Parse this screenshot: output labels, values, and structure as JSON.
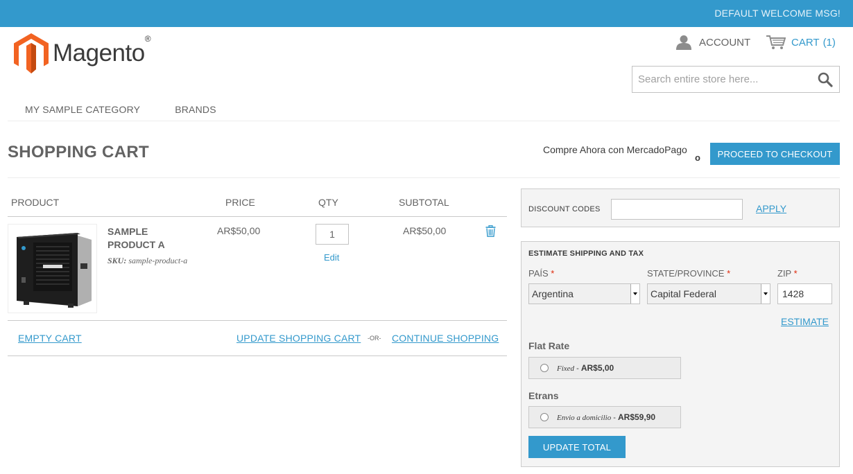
{
  "header": {
    "welcome": "DEFAULT WELCOME MSG!",
    "logo_text": "Magento",
    "logo_mark": "®",
    "account_label": "ACCOUNT",
    "cart_label": "CART",
    "cart_count": "(1)",
    "search_placeholder": "Search entire store here...",
    "accent_color": "#3399cc",
    "logo_color": "#f26322"
  },
  "nav": {
    "items": [
      {
        "label": "MY SAMPLE CATEGORY"
      },
      {
        "label": "BRANDS"
      }
    ]
  },
  "page": {
    "title": "SHOPPING CART",
    "mercadopago_text": "Compre Ahora con MercadoPago",
    "mercadopago_o": "o",
    "checkout_button": "PROCEED TO CHECKOUT"
  },
  "cart_table": {
    "headers": {
      "product": "PRODUCT",
      "price": "PRICE",
      "qty": "QTY",
      "subtotal": "SUBTOTAL"
    },
    "items": [
      {
        "name": "SAMPLE PRODUCT A",
        "sku_label": "SKU:",
        "sku": "sample-product-a",
        "price": "AR$50,00",
        "qty": "1",
        "edit_label": "Edit",
        "subtotal": "AR$50,00",
        "image_icon": "nas-device-image",
        "remove_icon": "trash-icon"
      }
    ],
    "actions": {
      "empty_cart": "EMPTY CART",
      "update_cart": "UPDATE SHOPPING CART",
      "or": "-OR-",
      "continue_shopping": "CONTINUE SHOPPING"
    }
  },
  "discount": {
    "label": "DISCOUNT CODES",
    "value": "",
    "apply": "APPLY"
  },
  "shipping": {
    "title": "ESTIMATE SHIPPING AND TAX",
    "country_label": "PAÍS",
    "country_value": "Argentina",
    "state_label": "STATE/PROVINCE",
    "state_value": "Capital Federal",
    "zip_label": "ZIP",
    "zip_value": "1428",
    "required_mark": "*",
    "estimate_link": "ESTIMATE",
    "methods": [
      {
        "title": "Flat Rate",
        "option": "Fixed",
        "sep": " - ",
        "price": "AR$5,00"
      },
      {
        "title": "Etrans",
        "option": "Envio a domicilio",
        "sep": " - ",
        "price": "AR$59,90"
      }
    ],
    "update_total": "UPDATE TOTAL"
  }
}
